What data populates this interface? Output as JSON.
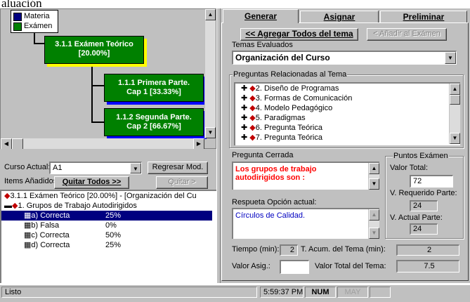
{
  "top_text": "aluación",
  "tree": {
    "legend": [
      "Materia",
      "Exámen"
    ],
    "legend_colors": [
      "#000080",
      "#008000"
    ],
    "root_node": [
      "3.1.1 Exámen Teórico",
      "[20.00%]"
    ],
    "child1": [
      "1.1.1 Primera Parte.",
      "Cap 1 [33.33%]"
    ],
    "child2": [
      "1.1.2 Segunda Parte.",
      "Cap 2 [66.67%]"
    ]
  },
  "left_form": {
    "curso_label": "Curso Actual:",
    "curso_value": "A1",
    "regresar_label": "Regresar Mod.",
    "items_label": "Items Añadidos:",
    "quitar_todos_label": "Quitar Todos >>",
    "quitar_label": "Quitar >"
  },
  "items_list": {
    "header": "3.1.1 Exámen Teórico [20.00%] - [Organización del  Cu",
    "question": "1. Grupos de Trabajo Autodirigidos",
    "answers": [
      {
        "label": "a) Correcta",
        "pct": "25%"
      },
      {
        "label": "b) Falsa",
        "pct": "0%"
      },
      {
        "label": "c) Correcta",
        "pct": "50%"
      },
      {
        "label": "d) Correcta",
        "pct": "25%"
      }
    ]
  },
  "tabs": [
    "Generar",
    "Asignar",
    "Preliminar"
  ],
  "right": {
    "agregar_todos_label": "<< Agregar Todos del tema",
    "anadir_label": "< Añadir al Exámen",
    "temas_label": "Temas Evaluados",
    "temas_value": "Organización del  Curso",
    "preguntas_label": "Preguntas Relacionadas al Tema",
    "preguntas": [
      "2. Diseño de Programas",
      "3. Formas de Comunicación",
      "4. Modelo Pedagógico",
      "5. Paradigmas",
      "6. Pregunta Teórica",
      "7. Pregunta Teórica"
    ],
    "pregunta_cerrada_label": "Pregunta Cerrada",
    "pregunta_cerrada_text": "Los grupos de trabajo autodirigidos son :",
    "puntos_label": "Puntos Exámen",
    "valor_total_label": "Valor Total:",
    "valor_total_value": "72",
    "v_requerido_label": "V. Requerido Parte:",
    "v_requerido_value": "24",
    "v_actual_label": "V. Actual Parte:",
    "v_actual_value": "24",
    "respuesta_label": "Respueta Opción actual:",
    "respuesta_text": "Círculos de Calidad.",
    "tiempo_label": "Tiempo (min):",
    "tiempo_value": "2",
    "t_acum_label": "T. Acum. del Tema (min):",
    "t_acum_value": "2",
    "valor_asig_label": "Valor Asig.:",
    "valor_asig_value": "",
    "valor_total_tema_label": "Valor Total del Tema:",
    "valor_total_tema_value": "7.5"
  },
  "status": {
    "text": "Listo",
    "time": "5:59:37 PM",
    "num": "NUM",
    "may": "MAY"
  }
}
